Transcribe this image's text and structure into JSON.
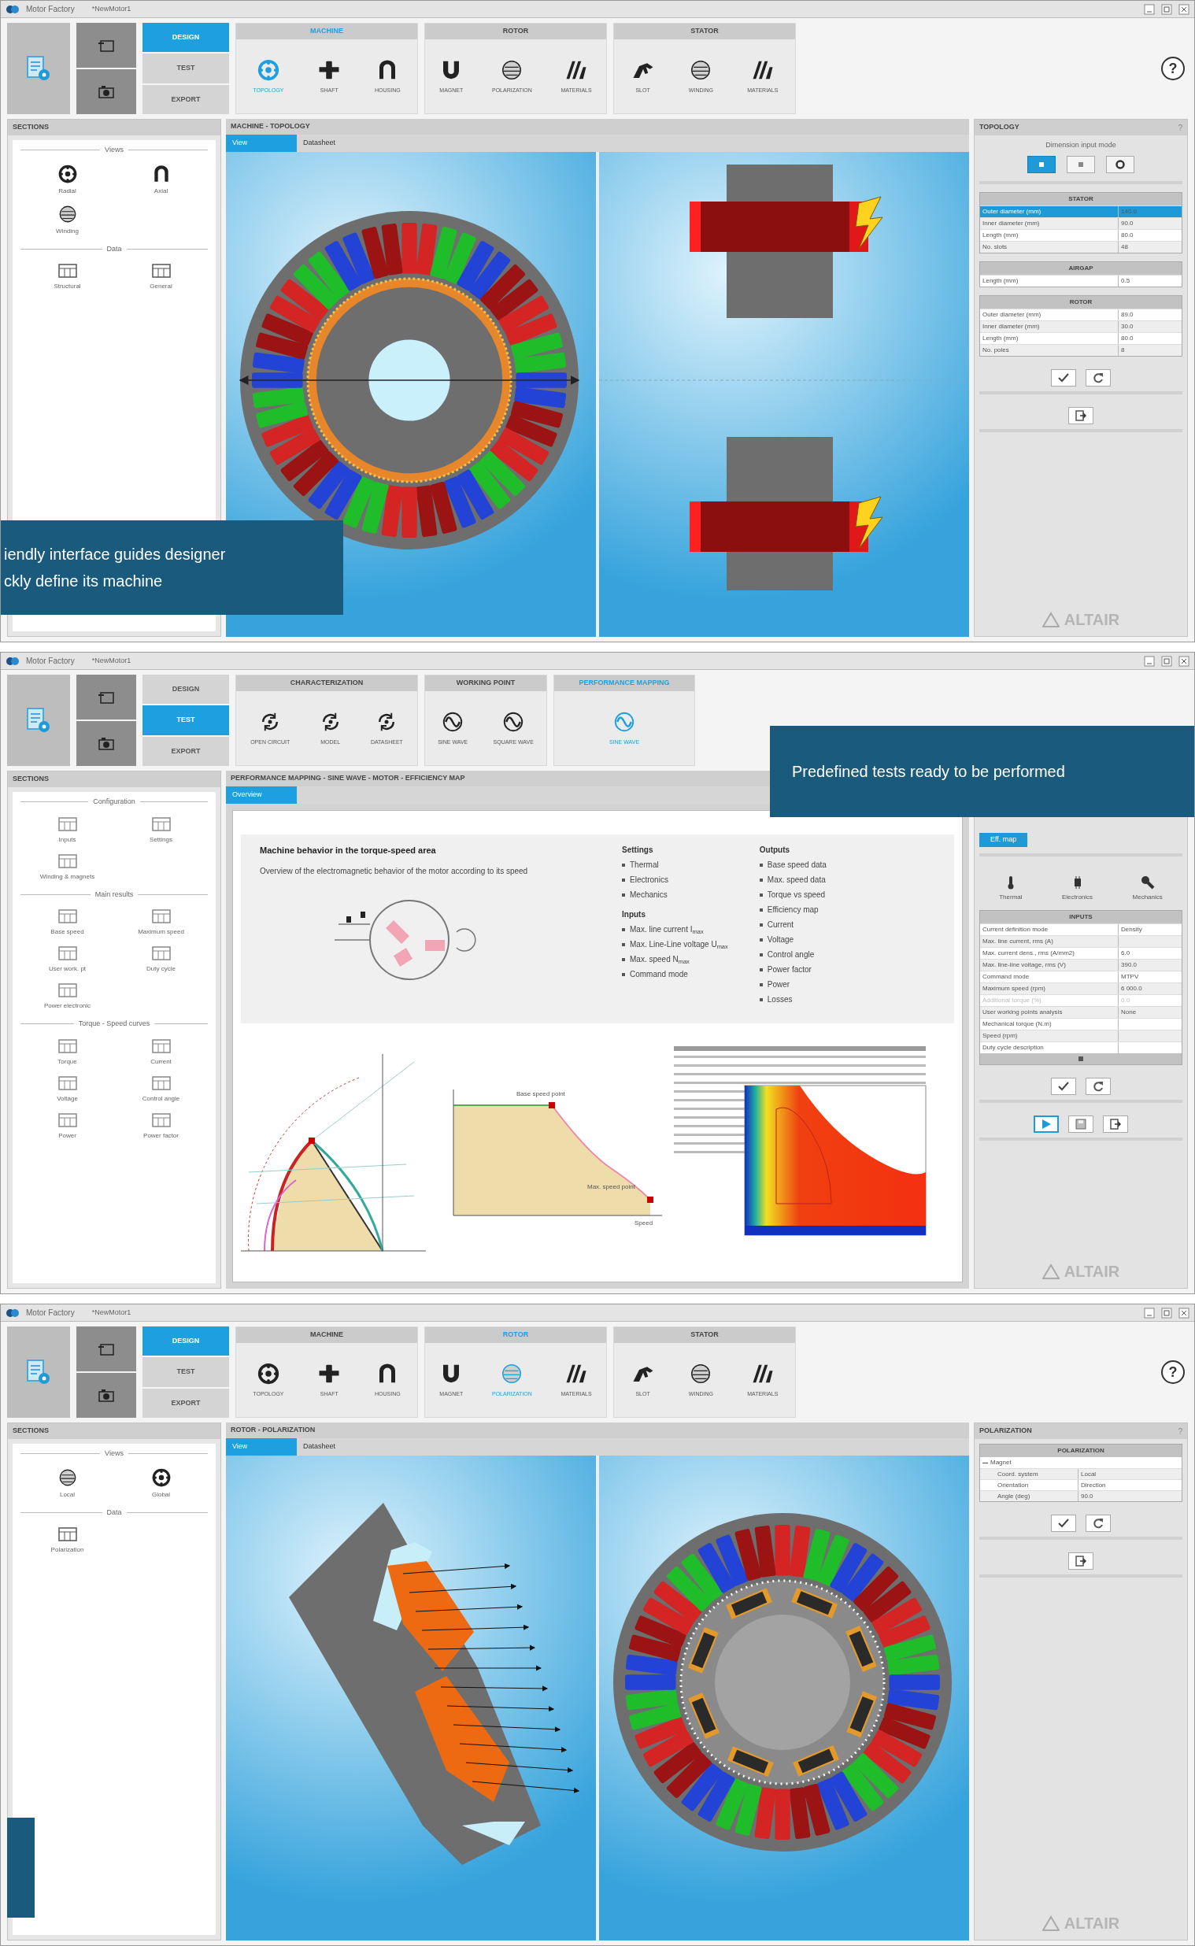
{
  "windows": [
    {
      "title": "Motor Factory",
      "document": "*NewMotor1",
      "mode_tabs": [
        {
          "label": "DESIGN",
          "selected": true
        },
        {
          "label": "TEST",
          "selected": false
        },
        {
          "label": "EXPORT",
          "selected": false
        }
      ],
      "ribbon_groups": [
        {
          "title": "MACHINE",
          "selected": true,
          "items": [
            {
              "label": "TOPOLOGY",
              "selected": true
            },
            {
              "label": "SHAFT",
              "selected": false
            },
            {
              "label": "HOUSING",
              "selected": false
            }
          ]
        },
        {
          "title": "ROTOR",
          "selected": false,
          "items": [
            {
              "label": "MAGNET",
              "selected": false
            },
            {
              "label": "POLARIZATION",
              "selected": false
            },
            {
              "label": "MATERIALS",
              "selected": false
            }
          ]
        },
        {
          "title": "STATOR",
          "selected": false,
          "items": [
            {
              "label": "SLOT",
              "selected": false
            },
            {
              "label": "WINDING",
              "selected": false
            },
            {
              "label": "MATERIALS",
              "selected": false
            }
          ]
        }
      ],
      "help": "?",
      "sections": {
        "title": "SECTIONS",
        "groups": [
          {
            "title": "Views",
            "items": [
              "Radial",
              "Axial",
              "Winding"
            ]
          },
          {
            "title": "Data",
            "items": [
              "Structural",
              "General"
            ]
          }
        ]
      },
      "breadcrumb": "MACHINE - TOPOLOGY",
      "view_tabs": [
        {
          "label": "View",
          "selected": true
        },
        {
          "label": "Datasheet",
          "selected": false
        }
      ],
      "content": {
        "kind": "views",
        "views": [
          {
            "kind": "radial"
          },
          {
            "kind": "axial"
          }
        ]
      },
      "right_panel": {
        "title": "TOPOLOGY",
        "help": "?",
        "blocks": [
          {
            "kind": "mode-selector",
            "title": "Dimension input mode",
            "buttons": [
              {
                "selected": true
              },
              {
                "selected": false
              },
              {
                "selected": false
              }
            ]
          },
          {
            "kind": "table",
            "title": "STATOR",
            "rows": [
              {
                "label": "Outer diameter (mm)",
                "value": "140.0",
                "selected": true
              },
              {
                "label": "Inner diameter (mm)",
                "value": "90.0",
                "selected": false
              },
              {
                "label": "Length (mm)",
                "value": "80.0",
                "selected": false
              },
              {
                "label": "No. slots",
                "value": "48",
                "selected": false
              }
            ]
          },
          {
            "kind": "table",
            "title": "AIRGAP",
            "rows": [
              {
                "label": "Length (mm)",
                "value": "0.5"
              }
            ]
          },
          {
            "kind": "table",
            "title": "ROTOR",
            "rows": [
              {
                "label": "Outer diameter (mm)",
                "value": "89.0"
              },
              {
                "label": "Inner diameter (mm)",
                "value": "30.0"
              },
              {
                "label": "Length (mm)",
                "value": "80.0"
              },
              {
                "label": "No. poles",
                "value": "8"
              }
            ]
          },
          {
            "kind": "actions",
            "buttons": [
              {
                "kind": "apply"
              },
              {
                "kind": "reset"
              }
            ]
          },
          {
            "kind": "actions",
            "buttons": [
              {
                "kind": "export"
              }
            ]
          }
        ],
        "brand": "ALTAIR"
      },
      "banner": {
        "lines": [
          "iendly interface guides designer",
          "ckly define its machine"
        ]
      }
    },
    {
      "title": "Motor Factory",
      "document": "*NewMotor1",
      "mode_tabs": [
        {
          "label": "DESIGN",
          "selected": false
        },
        {
          "label": "TEST",
          "selected": true
        },
        {
          "label": "EXPORT",
          "selected": false
        }
      ],
      "ribbon_groups": [
        {
          "title": "CHARACTERIZATION",
          "selected": false,
          "items": [
            {
              "label": "OPEN CIRCUIT",
              "selected": false
            },
            {
              "label": "MODEL",
              "selected": false
            },
            {
              "label": "DATASHEET",
              "selected": false
            }
          ]
        },
        {
          "title": "WORKING POINT",
          "selected": false,
          "items": [
            {
              "label": "SINE WAVE",
              "selected": false
            },
            {
              "label": "SQUARE WAVE",
              "selected": false
            }
          ]
        },
        {
          "title": "PERFORMANCE MAPPING",
          "selected": true,
          "items": [
            {
              "label": "SINE WAVE",
              "selected": true
            }
          ]
        }
      ],
      "sections": {
        "title": "SECTIONS",
        "groups": [
          {
            "title": "Configuration",
            "items": [
              "Inputs",
              "Settings",
              "Winding & magnets"
            ]
          },
          {
            "title": "Main results",
            "items": [
              "Base speed",
              "Maximum speed",
              "User work. pt",
              "Duty cycle",
              "Power electronic"
            ]
          },
          {
            "title": "Torque - Speed curves",
            "items": [
              "Torque",
              "Current",
              "Voltage",
              "Control angle",
              "Power",
              "Power factor"
            ]
          }
        ]
      },
      "breadcrumb": "PERFORMANCE MAPPING - SINE WAVE - MOTOR - EFFICIENCY MAP",
      "view_tabs": [
        {
          "label": "Overview",
          "selected": true
        }
      ],
      "content": {
        "kind": "document",
        "heading": "Machine behavior in the torque-speed area",
        "description": "Overview of the electromagnetic behavior of the motor according to its speed",
        "lists": [
          {
            "title": "Settings",
            "items": [
              "Thermal",
              "Electronics",
              "Mechanics"
            ]
          },
          {
            "title": "Inputs",
            "items": [
              "Max. line current I$_{max}$",
              "Max. Line-Line voltage U$_{max}$",
              "Max. speed N$_{max}$",
              "Command mode"
            ]
          },
          {
            "title": "Outputs",
            "items": [
              "Base speed data",
              "Max. speed data",
              "Torque vs speed",
              "Efficiency map",
              "Current",
              "Voltage",
              "Control angle",
              "Power factor",
              "Power",
              "Losses"
            ]
          }
        ],
        "curve_labels": [
          "Base speed point",
          "Max. speed point",
          "Speed"
        ]
      },
      "right_panel": {
        "blocks": [
          {
            "kind": "tab",
            "label": "Eff. map",
            "selected": true
          },
          {
            "kind": "icon-row",
            "items": [
              "Thermal",
              "Electronics",
              "Mechanics"
            ]
          },
          {
            "kind": "table",
            "title": "INPUTS",
            "rows": [
              {
                "label": "Current definition mode",
                "value": "Density",
                "disabled": false
              },
              {
                "label": "Max. line current, rms (A)",
                "value": "",
                "disabled": false
              },
              {
                "label": "Max. current dens., rms (A/mm2)",
                "value": "6.0",
                "disabled": false
              },
              {
                "label": "Max. line-line voltage, rms (V)",
                "value": "390.0",
                "disabled": false
              },
              {
                "label": "Command mode",
                "value": "MTPV",
                "disabled": false
              },
              {
                "label": "Maximum speed (rpm)",
                "value": "6 000.0",
                "disabled": false
              },
              {
                "label": "Additional torque (%)",
                "value": "0.0",
                "disabled": true
              },
              {
                "label": "User working points analysis",
                "value": "None",
                "disabled": false
              },
              {
                "label": "Mechanical torque (N.m)",
                "value": "",
                "disabled": false
              },
              {
                "label": "Speed (rpm)",
                "value": "",
                "disabled": false
              },
              {
                "label": "Duty cycle description",
                "value": "",
                "disabled": false
              }
            ]
          },
          {
            "kind": "actions",
            "buttons": [
              {
                "kind": "apply"
              },
              {
                "kind": "reset"
              }
            ]
          },
          {
            "kind": "actions",
            "buttons": [
              {
                "kind": "run"
              },
              {
                "kind": "save"
              },
              {
                "kind": "export"
              }
            ]
          }
        ],
        "brand": "ALTAIR"
      },
      "banner": {
        "lines": [
          "Predefined tests ready to be performed"
        ]
      }
    },
    {
      "title": "Motor Factory",
      "document": "*NewMotor1",
      "mode_tabs": [
        {
          "label": "DESIGN",
          "selected": true
        },
        {
          "label": "TEST",
          "selected": false
        },
        {
          "label": "EXPORT",
          "selected": false
        }
      ],
      "ribbon_groups": [
        {
          "title": "MACHINE",
          "selected": false,
          "items": [
            {
              "label": "TOPOLOGY",
              "selected": false
            },
            {
              "label": "SHAFT",
              "selected": false
            },
            {
              "label": "HOUSING",
              "selected": false
            }
          ]
        },
        {
          "title": "ROTOR",
          "selected": true,
          "items": [
            {
              "label": "MAGNET",
              "selected": false
            },
            {
              "label": "POLARIZATION",
              "selected": true
            },
            {
              "label": "MATERIALS",
              "selected": false
            }
          ]
        },
        {
          "title": "STATOR",
          "selected": false,
          "items": [
            {
              "label": "SLOT",
              "selected": false
            },
            {
              "label": "WINDING",
              "selected": false
            },
            {
              "label": "MATERIALS",
              "selected": false
            }
          ]
        }
      ],
      "help": "?",
      "sections": {
        "title": "SECTIONS",
        "groups": [
          {
            "title": "Views",
            "items": [
              "Local",
              "Global"
            ]
          },
          {
            "title": "Data",
            "items": [
              "Polarization"
            ]
          }
        ]
      },
      "breadcrumb": "ROTOR - POLARIZATION",
      "view_tabs": [
        {
          "label": "View",
          "selected": true
        },
        {
          "label": "Datasheet",
          "selected": false
        }
      ],
      "content": {
        "kind": "views",
        "views": [
          {
            "kind": "local"
          },
          {
            "kind": "global"
          }
        ]
      },
      "right_panel": {
        "title": "POLARIZATION",
        "help": "?",
        "blocks": [
          {
            "kind": "tree-table",
            "title": "POLARIZATION",
            "node": {
              "label": "Magnet",
              "expanded": true,
              "children": [
                {
                  "label": "Coord. system",
                  "value": "Local"
                },
                {
                  "label": "Orientation",
                  "value": "Direction"
                },
                {
                  "label": "Angle (deg)",
                  "value": "90.0"
                }
              ]
            }
          },
          {
            "kind": "actions",
            "buttons": [
              {
                "kind": "apply"
              },
              {
                "kind": "reset"
              }
            ]
          },
          {
            "kind": "actions",
            "buttons": [
              {
                "kind": "export"
              }
            ]
          }
        ],
        "brand": "ALTAIR"
      },
      "banner_strip": true
    }
  ]
}
